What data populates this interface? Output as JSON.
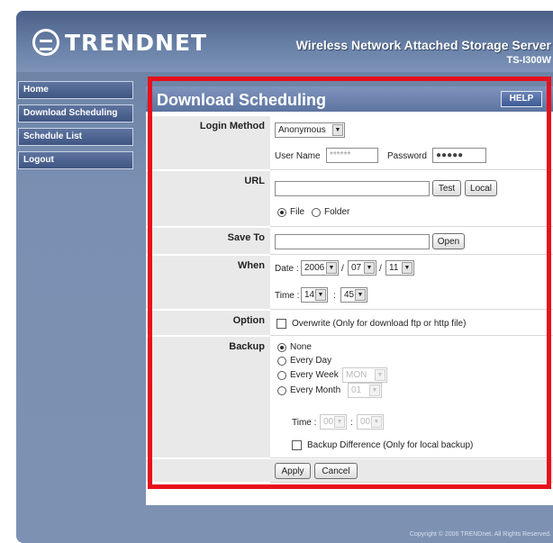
{
  "header": {
    "brand": "TRENDNET",
    "product": "Wireless Network Attached Storage Server",
    "model": "TS-I300W"
  },
  "nav": [
    {
      "label": "Home"
    },
    {
      "label": "Download Scheduling"
    },
    {
      "label": "Schedule List"
    },
    {
      "label": "Logout"
    }
  ],
  "page": {
    "title": "Download Scheduling",
    "help": "HELP"
  },
  "form": {
    "login_method": {
      "label": "Login Method",
      "value": "Anonymous",
      "user_label": "User Name",
      "user_value": "******",
      "pass_label": "Password",
      "pass_value": "●●●●●"
    },
    "url": {
      "label": "URL",
      "value": "",
      "test": "Test",
      "local": "Local",
      "file": "File",
      "folder": "Folder"
    },
    "save_to": {
      "label": "Save To",
      "value": "",
      "open": "Open"
    },
    "when": {
      "label": "When",
      "date_label": "Date :",
      "year": "2006",
      "month": "07",
      "day": "11",
      "sep": "/",
      "time_label": "Time :",
      "hour": "14",
      "minute": "45",
      "colon": ":"
    },
    "option": {
      "label": "Option",
      "overwrite": "Overwrite (Only for download ftp or http file)"
    },
    "backup": {
      "label": "Backup",
      "none": "None",
      "every_day": "Every Day",
      "every_week": "Every Week",
      "week_value": "MON",
      "every_month": "Every Month",
      "month_value": "01",
      "time_label": "Time :",
      "hour": "00",
      "minute": "00",
      "colon": ":",
      "difference": "Backup Difference (Only for local backup)"
    },
    "apply": "Apply",
    "cancel": "Cancel"
  },
  "footer": "Copyright © 2006 TRENDnet. All Rights Reserved.",
  "colors": {
    "highlight": "#e8101c",
    "panel": "#7a90b2",
    "title_bar": "#5d74a0"
  }
}
